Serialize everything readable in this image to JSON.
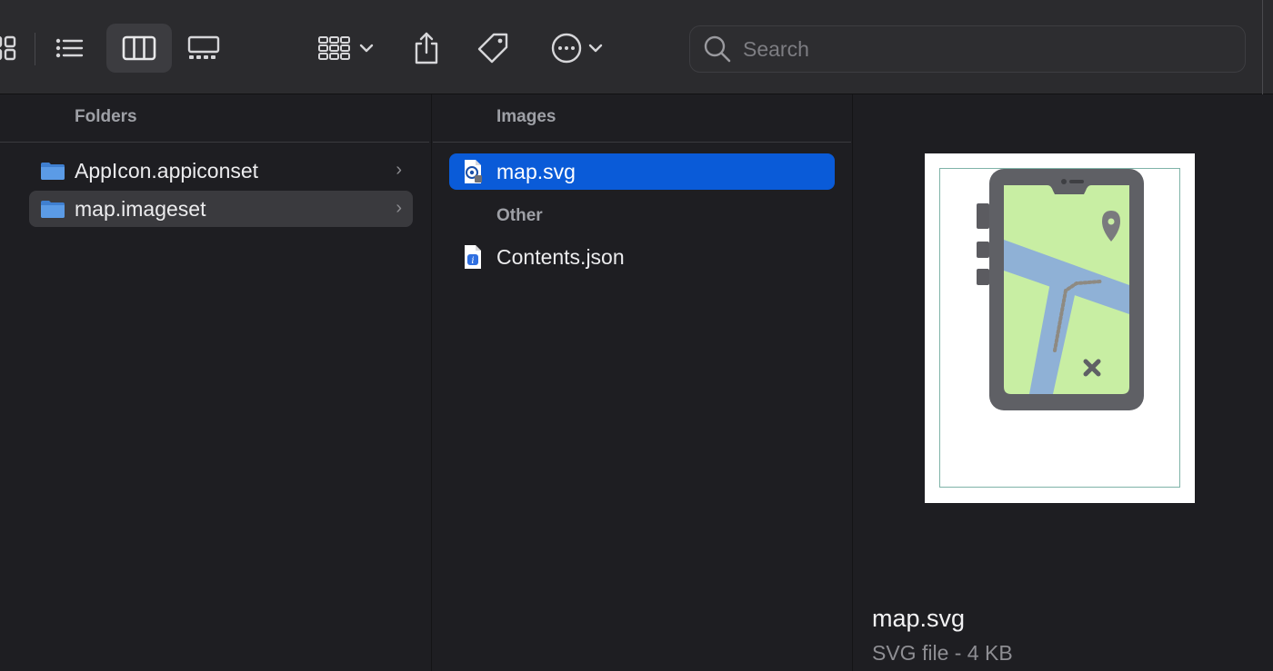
{
  "toolbar": {
    "views": [
      {
        "name": "icon-view",
        "icon": "grid-icon"
      },
      {
        "name": "list-view",
        "icon": "list-icon"
      },
      {
        "name": "column-view",
        "icon": "columns-icon",
        "active": true
      },
      {
        "name": "gallery-view",
        "icon": "gallery-icon"
      }
    ],
    "group_icon": "group-by-icon",
    "share_icon": "share-icon",
    "tag_icon": "tag-icon",
    "more_icon": "ellipsis-circle-icon",
    "search": {
      "placeholder": "Search",
      "value": ""
    }
  },
  "columns": {
    "folders": {
      "header": "Folders",
      "items": [
        {
          "label": "AppIcon.appiconset",
          "icon": "folder-icon",
          "selected": false
        },
        {
          "label": "map.imageset",
          "icon": "folder-icon",
          "selected": true
        }
      ]
    },
    "files": {
      "header": "Images",
      "items": [
        {
          "label": "map.svg",
          "icon": "svg-file-icon",
          "selected": true
        }
      ],
      "other_header": "Other",
      "other_items": [
        {
          "label": "Contents.json",
          "icon": "json-file-icon",
          "selected": false
        }
      ]
    }
  },
  "preview": {
    "filename": "map.svg",
    "meta": "SVG file - 4 KB"
  },
  "colors": {
    "accent": "#0a5bd8",
    "folder": "#4a90e2",
    "background": "#1e1e22",
    "toolbar": "#2b2b2e"
  }
}
